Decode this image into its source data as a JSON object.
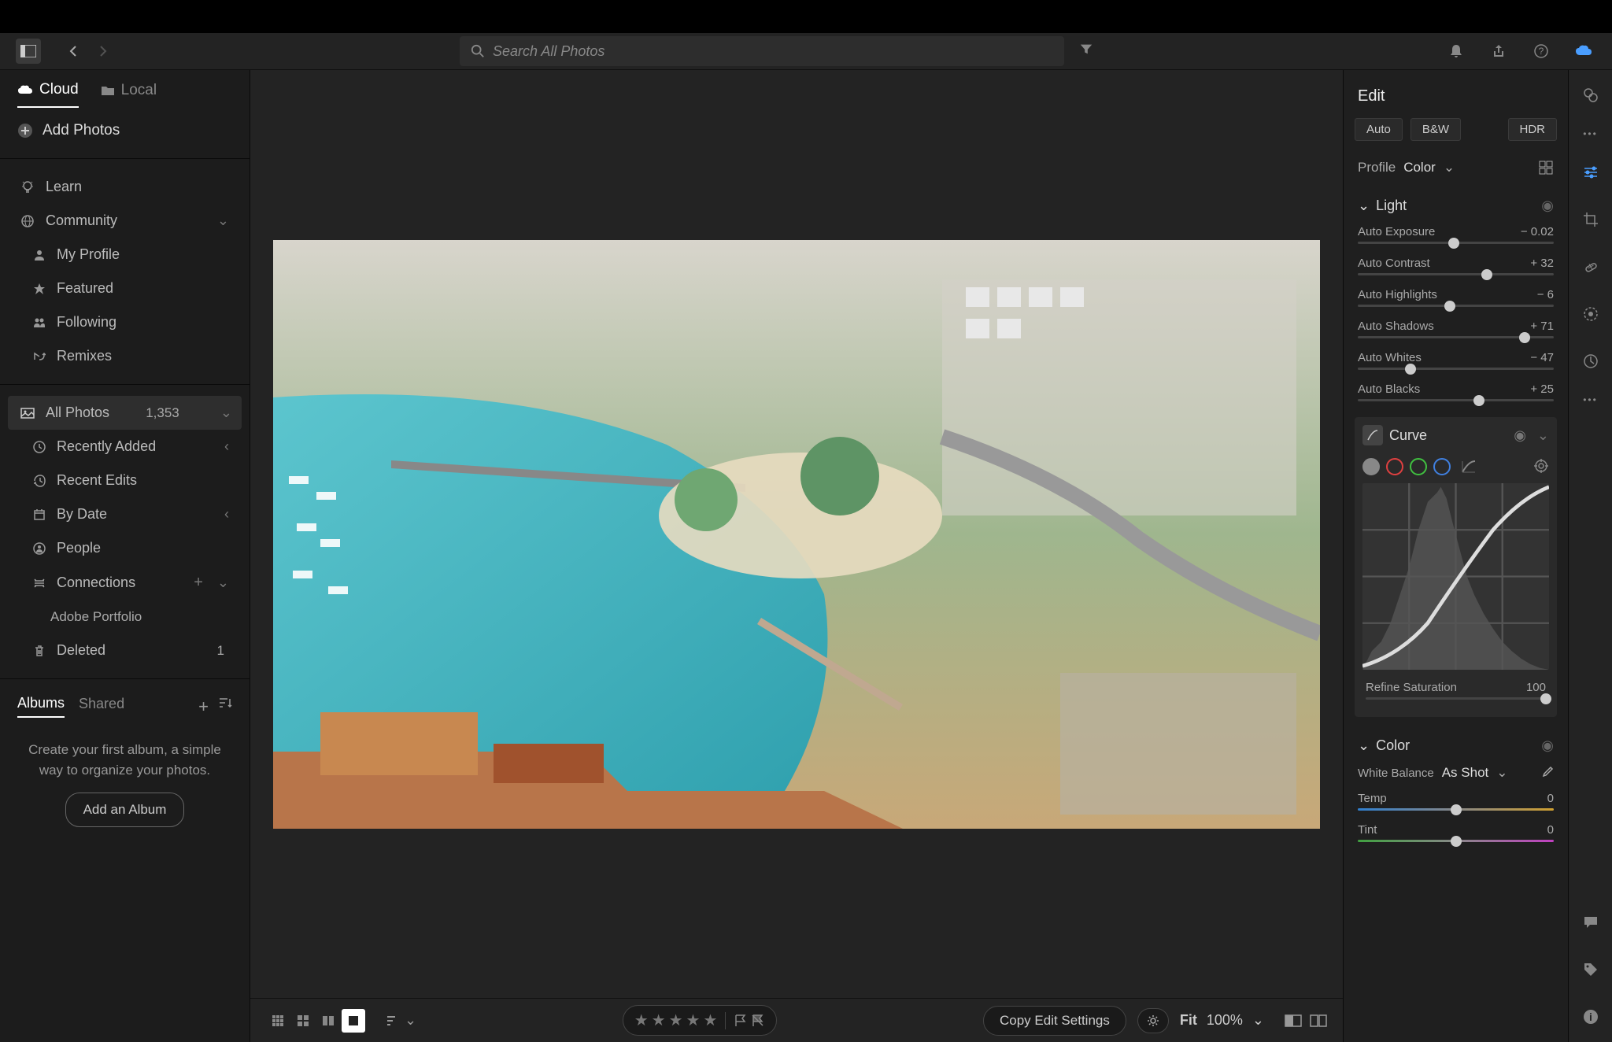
{
  "toolbar": {
    "search_placeholder": "Search All Photos"
  },
  "sidebar": {
    "tabs": {
      "cloud": "Cloud",
      "local": "Local"
    },
    "add_photos": "Add Photos",
    "learn": "Learn",
    "community": "Community",
    "my_profile": "My Profile",
    "featured": "Featured",
    "following": "Following",
    "remixes": "Remixes",
    "all_photos": "All Photos",
    "all_photos_count": "1,353",
    "recently_added": "Recently Added",
    "recent_edits": "Recent Edits",
    "by_date": "By Date",
    "people": "People",
    "connections": "Connections",
    "adobe_portfolio": "Adobe Portfolio",
    "deleted": "Deleted",
    "deleted_count": "1",
    "albums_tab": "Albums",
    "shared_tab": "Shared",
    "albums_empty": "Create your first album, a simple way to organize your photos.",
    "add_album": "Add an Album"
  },
  "bottom": {
    "copy_settings": "Copy Edit Settings",
    "fit": "Fit",
    "zoom": "100%"
  },
  "edit": {
    "title": "Edit",
    "auto": "Auto",
    "bw": "B&W",
    "hdr": "HDR",
    "profile_label": "Profile",
    "profile_value": "Color",
    "light": "Light",
    "sliders": [
      {
        "label": "Auto Exposure",
        "value": "− 0.02",
        "pos": 49
      },
      {
        "label": "Auto Contrast",
        "value": "+ 32",
        "pos": 66
      },
      {
        "label": "Auto Highlights",
        "value": "− 6",
        "pos": 47
      },
      {
        "label": "Auto Shadows",
        "value": "+ 71",
        "pos": 85
      },
      {
        "label": "Auto Whites",
        "value": "− 47",
        "pos": 27
      },
      {
        "label": "Auto Blacks",
        "value": "+ 25",
        "pos": 62
      }
    ],
    "curve": "Curve",
    "refine_saturation": "Refine Saturation",
    "refine_saturation_val": "100",
    "color": "Color",
    "white_balance": "White Balance",
    "white_balance_val": "As Shot",
    "temp": "Temp",
    "temp_val": "0",
    "tint": "Tint",
    "tint_val": "0"
  }
}
